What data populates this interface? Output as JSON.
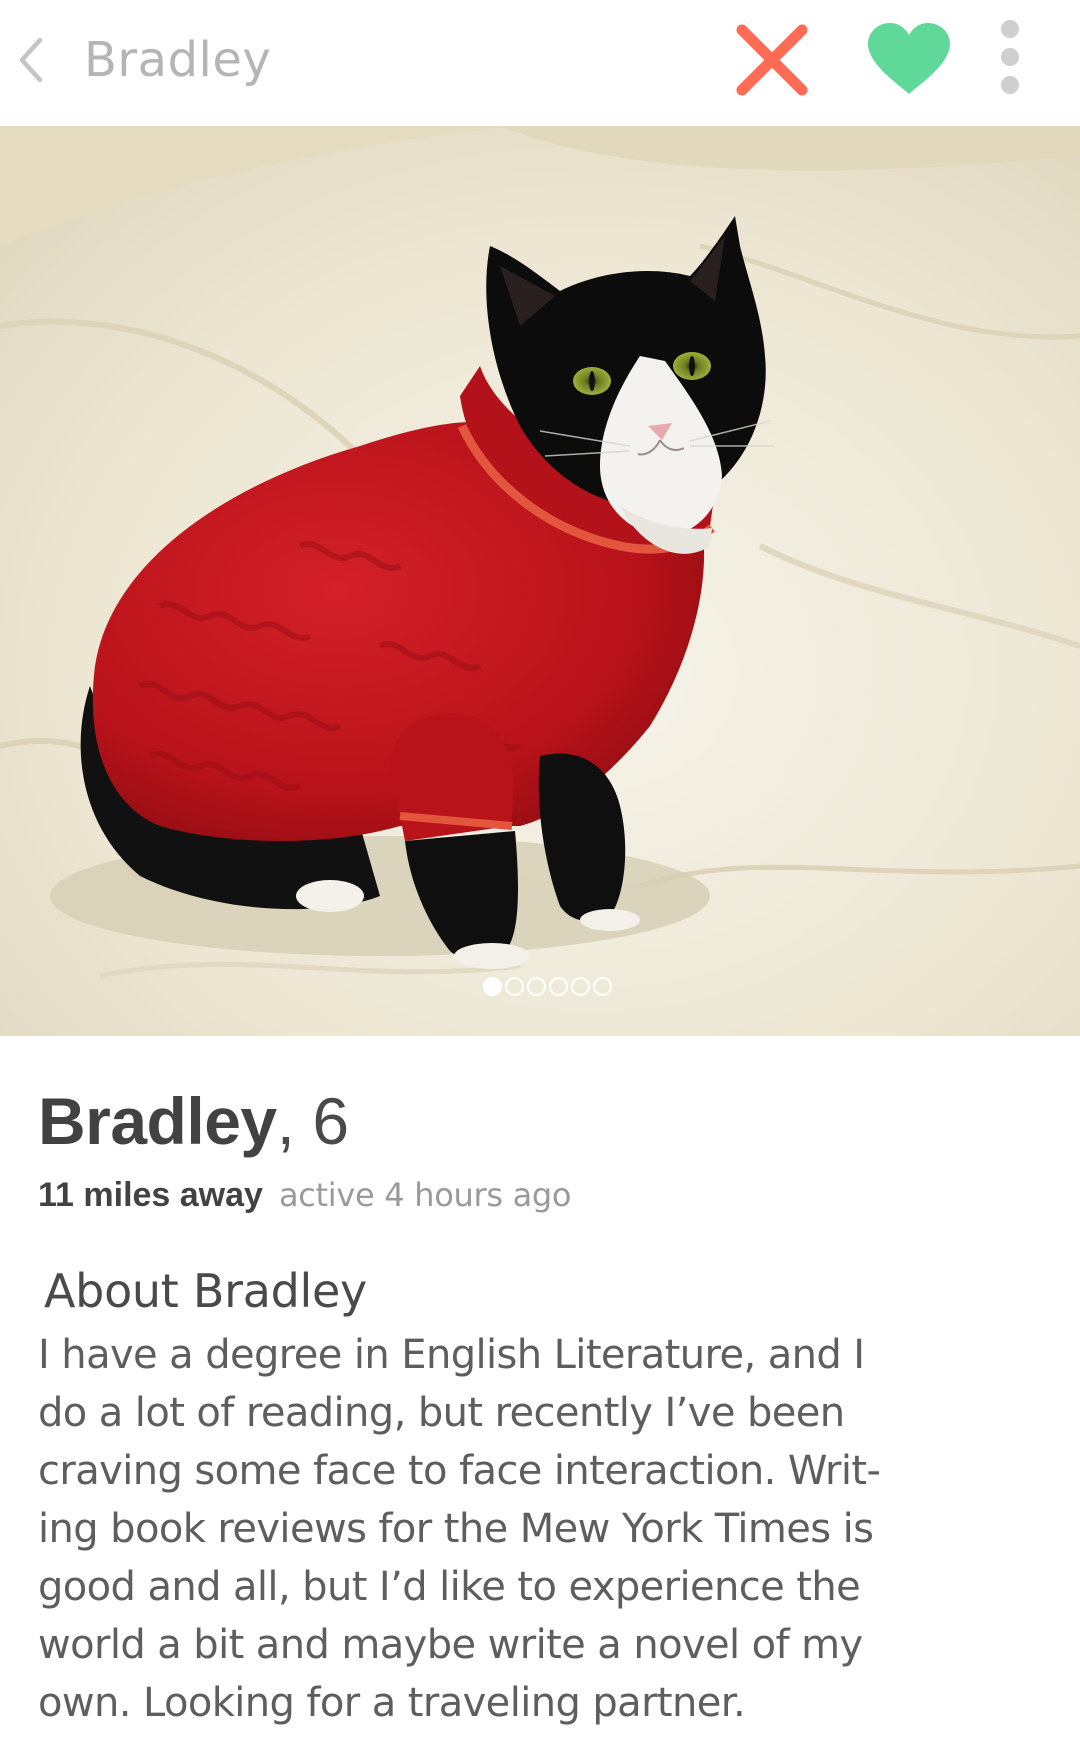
{
  "header": {
    "title": "Bradley",
    "back_icon": "chevron-left-icon",
    "nope_icon": "close-icon",
    "like_icon": "heart-icon",
    "more_icon": "more-vertical-icon"
  },
  "photo": {
    "subject": "black and white cat wearing a red knit turtleneck sweater on a white comforter",
    "total_photos": 6,
    "active_index": 0
  },
  "profile": {
    "name": "Bradley",
    "age_separator": ", ",
    "age": "6",
    "distance": "11 miles away",
    "activity": "active 4 hours ago"
  },
  "about": {
    "title": "About Bradley",
    "bio_lines": [
      "I have a degree in English Literature, and I",
      "do a lot of reading, but recently I’ve been",
      "craving some face to face interaction. Writ-",
      "ing book reviews for the Mew York Times is",
      "good and all, but I’d like to experience the",
      "world a bit and maybe write a novel of my",
      "own. Looking for a traveling partner."
    ]
  },
  "colors": {
    "nope": "#ff6b55",
    "like": "#5fd89a",
    "header_title": "#b5b5b5",
    "more_dots": "#cfcfcf",
    "sweater": "#c8161d",
    "name_text": "#424242",
    "secondary_text": "#9a9a9a"
  }
}
